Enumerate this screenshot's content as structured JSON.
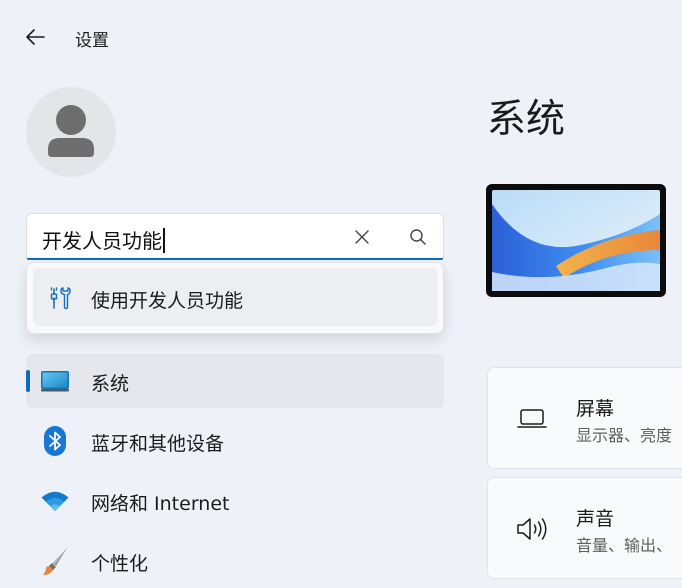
{
  "app": {
    "title": "设置"
  },
  "search": {
    "value": "开发人员功能"
  },
  "suggestions": [
    {
      "label": "使用开发人员功能",
      "icon": "developer-tools-icon"
    }
  ],
  "nav": {
    "items": [
      {
        "label": "系统",
        "icon": "system-display-icon",
        "selected": true
      },
      {
        "label": "蓝牙和其他设备",
        "icon": "bluetooth-icon"
      },
      {
        "label": "网络和 Internet",
        "icon": "wifi-icon"
      },
      {
        "label": "个性化",
        "icon": "paintbrush-icon"
      }
    ]
  },
  "main": {
    "title": "系统",
    "cards": [
      {
        "title": "屏幕",
        "desc": "显示器、亮度",
        "icon": "laptop-icon"
      },
      {
        "title": "声音",
        "desc": "音量、输出、",
        "icon": "speaker-icon"
      }
    ]
  },
  "colors": {
    "accent": "#0f6cbd",
    "background": "#eef2f8",
    "selected": "#e4e7ec"
  }
}
